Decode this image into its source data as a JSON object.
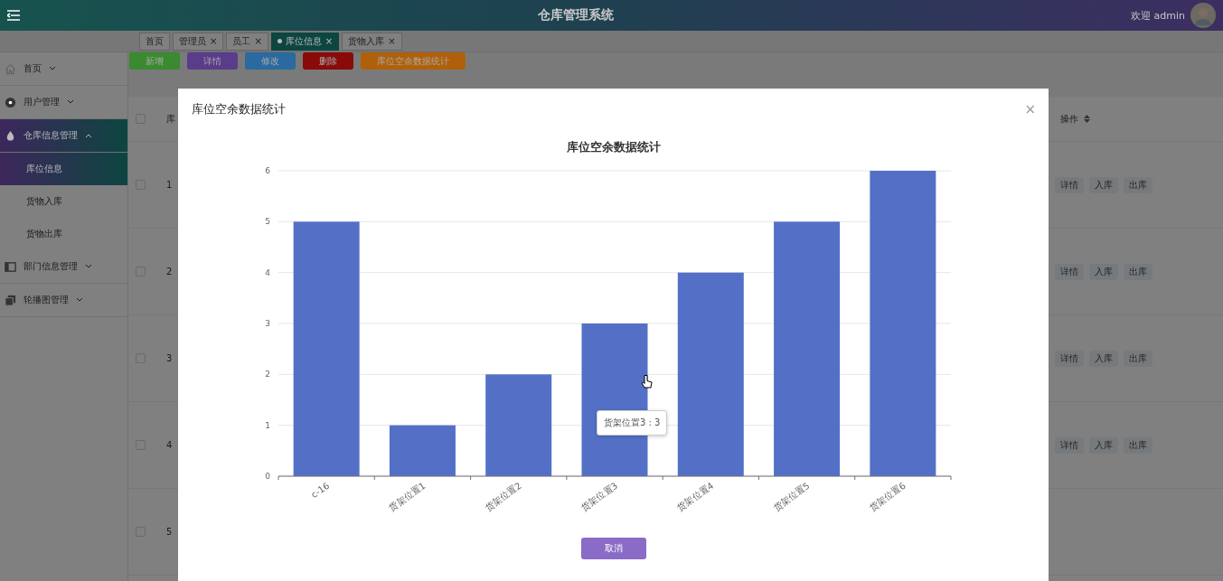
{
  "header": {
    "title": "仓库管理系统",
    "welcome": "欢迎 admin"
  },
  "tabs": [
    {
      "label": "首页",
      "selected": false
    },
    {
      "label": "管理员",
      "selected": false,
      "close": "×"
    },
    {
      "label": "员工",
      "selected": false,
      "close": "×"
    },
    {
      "label": "库位信息",
      "selected": true,
      "close": "×"
    },
    {
      "label": "货物入库",
      "selected": false,
      "close": "×"
    }
  ],
  "sidebar": {
    "items": [
      {
        "label": "首页",
        "expanded": false,
        "selected": false
      },
      {
        "label": "用户管理",
        "expanded": false,
        "selected": false
      },
      {
        "label": "仓库信息管理",
        "expanded": true,
        "selected": true,
        "children": [
          {
            "label": "库位信息",
            "selected": true
          },
          {
            "label": "货物入库",
            "selected": false
          },
          {
            "label": "货物出库",
            "selected": false
          }
        ]
      },
      {
        "label": "部门信息管理",
        "expanded": false,
        "selected": false
      },
      {
        "label": "轮播图管理",
        "expanded": false,
        "selected": false
      }
    ]
  },
  "actions": [
    {
      "label": "新增",
      "color": "#3a8a30"
    },
    {
      "label": "详情",
      "color": "#5a3c8a"
    },
    {
      "label": "修改",
      "color": "#2a6aa0"
    },
    {
      "label": "删除",
      "color": "#8a0a0a"
    },
    {
      "label": "库位空余数据统计",
      "color": "#b0600a"
    }
  ],
  "table": {
    "header_checked": false,
    "columns": [
      {
        "label": "库"
      },
      {
        "label": "操作"
      }
    ],
    "rows": [
      {
        "checked": false,
        "index": "1",
        "buttons": [
          "详情",
          "入库",
          "出库"
        ]
      },
      {
        "checked": false,
        "index": "2",
        "buttons": [
          "详情",
          "入库",
          "出库"
        ]
      },
      {
        "checked": false,
        "index": "3",
        "buttons": [
          "详情",
          "入库",
          "出库"
        ]
      },
      {
        "checked": false,
        "index": "4",
        "buttons": [
          "详情",
          "入库",
          "出库"
        ]
      },
      {
        "checked": false,
        "index": "5",
        "buttons": []
      }
    ]
  },
  "dialog": {
    "title": "库位空余数据统计",
    "close": "×",
    "tooltip": "货架位置3 : 3",
    "cancel": "取消",
    "chart_data": {
      "type": "bar",
      "title": "库位空余数据统计",
      "grid": true,
      "categories": [
        "c-16",
        "货架位置1",
        "货架位置2",
        "货架位置3",
        "货架位置4",
        "货架位置5",
        "货架位置6"
      ],
      "series": [
        {
          "color": "#5470c6",
          "values": [
            5,
            1,
            2,
            3,
            4,
            5,
            6
          ]
        }
      ],
      "ylim": [
        0,
        6
      ],
      "yticks": [
        0,
        1,
        2,
        3,
        4,
        5,
        6
      ]
    }
  }
}
